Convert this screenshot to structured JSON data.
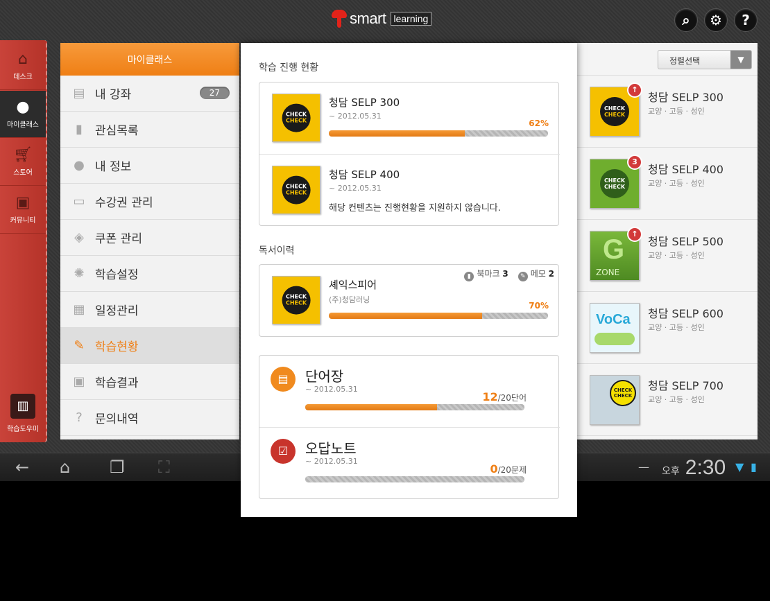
{
  "header": {
    "logo_smart": "smart",
    "logo_learning": "learning",
    "icons": [
      "search-icon",
      "gear-icon",
      "help-icon"
    ]
  },
  "rail": {
    "items": [
      {
        "label": "데스크",
        "icon": "home-icon"
      },
      {
        "label": "마이클래스",
        "icon": "person-icon"
      },
      {
        "label": "스토어",
        "icon": "cart-icon"
      },
      {
        "label": "커뮤니티",
        "icon": "chat-icon"
      }
    ],
    "helper_label": "학습도우미"
  },
  "menu": {
    "title": "마이클래스",
    "items": [
      {
        "label": "내 강좌",
        "badge": "27",
        "icon": "notebook-icon"
      },
      {
        "label": "관심목록",
        "icon": "bookmark-icon"
      },
      {
        "label": "내 정보",
        "icon": "person-icon"
      },
      {
        "label": "수강권 관리",
        "icon": "card-icon"
      },
      {
        "label": "쿠폰 관리",
        "icon": "tag-icon"
      },
      {
        "label": "학습설정",
        "icon": "gear-icon"
      },
      {
        "label": "일정관리",
        "icon": "calendar-icon"
      },
      {
        "label": "학습현황",
        "icon": "pencil-icon",
        "active": true
      },
      {
        "label": "학습결과",
        "icon": "presentation-icon"
      },
      {
        "label": "문의내역",
        "icon": "question-icon"
      }
    ]
  },
  "right": {
    "sort_label": "정렬선택",
    "books": [
      {
        "title": "청담 SELP 300",
        "sub": "교양 · 고등 · 성인",
        "cover": "check",
        "notice": "↑"
      },
      {
        "title": "청담 SELP 400",
        "sub": "교양 · 고등 · 성인",
        "cover": "greenbook",
        "notice": "3"
      },
      {
        "title": "청담 SELP 500",
        "sub": "교양 · 고등 · 성인",
        "cover": "gzone",
        "notice": "↑"
      },
      {
        "title": "청담 SELP 600",
        "sub": "교양 · 고등 · 성인",
        "cover": "voca",
        "notice": ""
      },
      {
        "title": "청담 SELP 700",
        "sub": "교양 · 고등 · 성인",
        "cover": "map",
        "notice": ""
      }
    ]
  },
  "popup": {
    "progress_title": "학습 진행 현황",
    "progress": [
      {
        "title": "청담 SELP 300",
        "date": "~ 2012.05.31",
        "percent_label": "62%",
        "percent": 0.62
      },
      {
        "title": "청담 SELP 400",
        "date": "~ 2012.05.31",
        "message": "해당 컨텐츠는 진행현황을 지원하지 않습니다."
      }
    ],
    "reading_title": "독서이력",
    "reading": {
      "title": "셰익스피어",
      "publisher": "(주)청담러닝",
      "bookmark_label": "북마크",
      "bookmark_count": "3",
      "memo_label": "메모",
      "memo_count": "2",
      "percent_label": "70%",
      "percent": 0.7
    },
    "tools": [
      {
        "title": "단어장",
        "date": "~ 2012.05.31",
        "count": "12",
        "total": "/20단어",
        "fraction": 0.6,
        "color": "#f08a1e",
        "icon": "notepad-icon"
      },
      {
        "title": "오답노트",
        "date": "~ 2012.05.31",
        "count": "0",
        "total": "/20문제",
        "fraction": 0,
        "color": "#c8342c",
        "icon": "check-icon"
      }
    ]
  },
  "cover_text": {
    "check_top": "CHECK",
    "check_bottom": "CHECK",
    "gzone_g": "G",
    "gzone_z": "ZONE",
    "voca": "VoCa"
  },
  "system": {
    "ampm": "오후",
    "time": "2:30"
  }
}
